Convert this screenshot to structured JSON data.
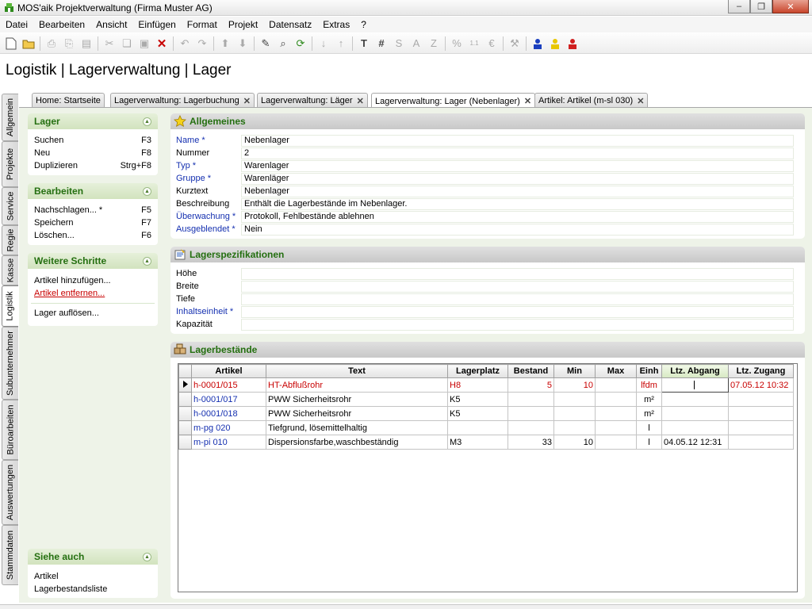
{
  "window": {
    "title": "MOS'aik Projektverwaltung (Firma Muster AG)",
    "minimize": "‒",
    "maximize": "❐",
    "close": "✕"
  },
  "menu": [
    "Datei",
    "Bearbeiten",
    "Ansicht",
    "Einfügen",
    "Format",
    "Projekt",
    "Datensatz",
    "Extras",
    "?"
  ],
  "breadcrumb": "Logistik | Lagerverwaltung | Lager",
  "vertical_tabs": [
    "Allgemein",
    "Projekte",
    "Service",
    "Regie",
    "Kasse",
    "Logistik",
    "Subunternehmer",
    "Büroarbeiten",
    "Auswertungen",
    "Stammdaten"
  ],
  "active_vertical_tab": "Logistik",
  "tabs": [
    {
      "label": "Home: Startseite",
      "closable": false
    },
    {
      "label": "Lagerverwaltung: Lagerbuchung",
      "closable": true
    },
    {
      "label": "Lagerverwaltung: Läger",
      "closable": true
    },
    {
      "label": "Lagerverwaltung: Lager (Nebenlager)",
      "closable": true,
      "active": true
    },
    {
      "label": "Artikel: Artikel (m-sl 030)",
      "closable": true
    }
  ],
  "tab_close": "✕",
  "left": {
    "lager": {
      "title": "Lager",
      "items": [
        {
          "label": "Suchen",
          "key": "F3"
        },
        {
          "label": "Neu",
          "key": "F8"
        },
        {
          "label": "Duplizieren",
          "key": "Strg+F8"
        }
      ]
    },
    "bearbeiten": {
      "title": "Bearbeiten",
      "items": [
        {
          "label": "Nachschlagen... *",
          "key": "F5"
        },
        {
          "label": "Speichern",
          "key": "F7"
        },
        {
          "label": "Löschen...",
          "key": "F6"
        }
      ]
    },
    "weitere": {
      "title": "Weitere Schritte",
      "items": [
        "Artikel hinzufügen...",
        "Artikel entfernen...",
        "Lager auflösen..."
      ]
    },
    "siehe": {
      "title": "Siehe auch",
      "items": [
        "Artikel",
        "Lagerbestandsliste"
      ]
    }
  },
  "allgemeines": {
    "title": "Allgemeines",
    "fields": [
      {
        "label": "Name *",
        "value": "Nebenlager",
        "required": true
      },
      {
        "label": "Nummer",
        "value": "2",
        "required": false
      },
      {
        "label": "Typ *",
        "value": "Warenlager",
        "required": true
      },
      {
        "label": "Gruppe *",
        "value": "Warenläger",
        "required": true
      },
      {
        "label": "Kurztext",
        "value": "Nebenlager",
        "required": false
      },
      {
        "label": "Beschreibung",
        "value": "Enthält die Lagerbestände im Nebenlager.",
        "required": false
      },
      {
        "label": "Überwachung *",
        "value": "Protokoll, Fehlbestände ablehnen",
        "required": true
      },
      {
        "label": "Ausgeblendet *",
        "value": "Nein",
        "required": true
      }
    ]
  },
  "spezifikationen": {
    "title": "Lagerspezifikationen",
    "fields": [
      {
        "label": "Höhe",
        "value": "",
        "required": false
      },
      {
        "label": "Breite",
        "value": "",
        "required": false
      },
      {
        "label": "Tiefe",
        "value": "",
        "required": false
      },
      {
        "label": "Inhaltseinheit *",
        "value": "",
        "required": true
      },
      {
        "label": "Kapazität",
        "value": "",
        "required": false
      }
    ]
  },
  "bestaende": {
    "title": "Lagerbestände",
    "columns": [
      "Artikel",
      "Text",
      "Lagerplatz",
      "Bestand",
      "Min",
      "Max",
      "Einh",
      "Ltz. Abgang",
      "Ltz. Zugang"
    ],
    "rows": [
      {
        "artikel": "h-0001/015",
        "text": "HT-Abflußrohr",
        "lagerplatz": "H8",
        "bestand": "5",
        "min": "10",
        "max": "",
        "einh": "lfdm",
        "abgang": "",
        "zugang": "07.05.12 10:32",
        "alert": true,
        "current": true
      },
      {
        "artikel": "h-0001/017",
        "text": "PWW Sicherheitsrohr",
        "lagerplatz": "K5",
        "bestand": "",
        "min": "",
        "max": "",
        "einh": "m²",
        "abgang": "",
        "zugang": "",
        "alert": false
      },
      {
        "artikel": "h-0001/018",
        "text": "PWW Sicherheitsrohr",
        "lagerplatz": "K5",
        "bestand": "",
        "min": "",
        "max": "",
        "einh": "m²",
        "abgang": "",
        "zugang": "",
        "alert": false
      },
      {
        "artikel": "m-pg 020",
        "text": "Tiefgrund, lösemittelhaltig",
        "lagerplatz": "",
        "bestand": "",
        "min": "",
        "max": "",
        "einh": "l",
        "abgang": "",
        "zugang": "",
        "alert": false
      },
      {
        "artikel": "m-pi 010",
        "text": "Dispersionsfarbe,waschbeständig",
        "lagerplatz": "M3",
        "bestand": "33",
        "min": "10",
        "max": "",
        "einh": "l",
        "abgang": "04.05.12 12:31",
        "zugang": "",
        "alert": false
      }
    ]
  },
  "colors": {
    "accent_green": "#246f10",
    "required_blue": "#1530b0",
    "alert_red": "#c80000",
    "panel_bg": "#eef3e8"
  }
}
